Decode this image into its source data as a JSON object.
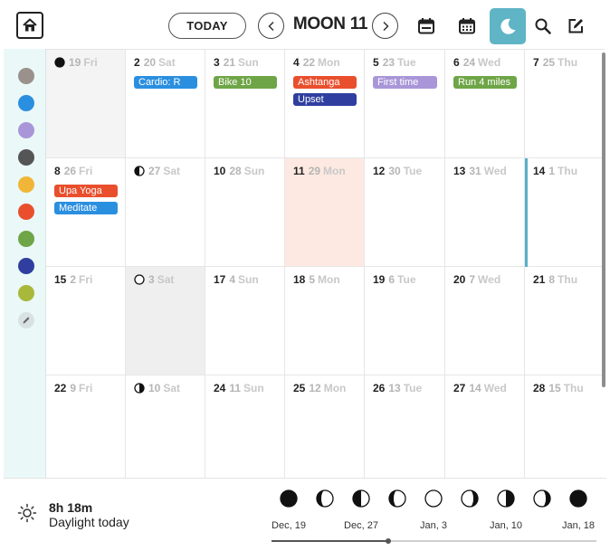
{
  "header": {
    "today_label": "TODAY",
    "title": "MOON 11",
    "home_icon": "home-icon",
    "prev_icon": "chevron-left-icon",
    "next_icon": "chevron-right-icon",
    "tools": [
      "week-calendar-icon",
      "month-calendar-icon",
      "moon-icon",
      "search-icon",
      "edit-icon"
    ],
    "active_tool": "moon-icon",
    "accent_color": "#5fb4c6"
  },
  "sidebar": {
    "swatches": [
      "#9a918d",
      "#2b8fe0",
      "#a996d8",
      "#555555",
      "#f1b637",
      "#e94f2d",
      "#6ea547",
      "#303f9f",
      "#a8b83b"
    ],
    "edit_icon": "pencil-icon"
  },
  "weeks": [
    [
      {
        "g": "",
        "m": "19",
        "w": "Fri",
        "moon": "new",
        "shade": true,
        "events": []
      },
      {
        "g": "2",
        "m": "20",
        "w": "Sat",
        "events": [
          {
            "label": "Cardio: R",
            "color": "#2b8fe0"
          }
        ]
      },
      {
        "g": "3",
        "m": "21",
        "w": "Sun",
        "events": [
          {
            "label": "Bike 10",
            "color": "#6ea547"
          }
        ]
      },
      {
        "g": "4",
        "m": "22",
        "w": "Mon",
        "events": [
          {
            "label": "Ashtanga",
            "color": "#e94f2d"
          },
          {
            "label": "Upset",
            "color": "#303f9f"
          }
        ]
      },
      {
        "g": "5",
        "m": "23",
        "w": "Tue",
        "events": [
          {
            "label": "First time",
            "color": "#a996d8"
          }
        ]
      },
      {
        "g": "6",
        "m": "24",
        "w": "Wed",
        "events": [
          {
            "label": "Run 4 miles",
            "color": "#6ea547"
          }
        ]
      },
      {
        "g": "7",
        "m": "25",
        "w": "Thu",
        "events": []
      }
    ],
    [
      {
        "g": "8",
        "m": "26",
        "w": "Fri",
        "events": [
          {
            "label": "Upa Yoga",
            "color": "#e94f2d"
          },
          {
            "label": "Meditate",
            "color": "#2b8fe0"
          }
        ]
      },
      {
        "g": "",
        "m": "27",
        "w": "Sat",
        "moon": "first-quarter",
        "events": []
      },
      {
        "g": "10",
        "m": "28",
        "w": "Sun",
        "events": []
      },
      {
        "g": "11",
        "m": "29",
        "w": "Mon",
        "today": true,
        "events": []
      },
      {
        "g": "12",
        "m": "30",
        "w": "Tue",
        "events": []
      },
      {
        "g": "13",
        "m": "31",
        "w": "Wed",
        "events": []
      },
      {
        "g": "14",
        "m": "1",
        "w": "Thu",
        "now_marker": true,
        "events": []
      }
    ],
    [
      {
        "g": "15",
        "m": "2",
        "w": "Fri",
        "events": []
      },
      {
        "g": "",
        "m": "3",
        "w": "Sat",
        "moon": "full",
        "shade2": true,
        "events": []
      },
      {
        "g": "17",
        "m": "4",
        "w": "Sun",
        "events": []
      },
      {
        "g": "18",
        "m": "5",
        "w": "Mon",
        "events": []
      },
      {
        "g": "19",
        "m": "6",
        "w": "Tue",
        "events": []
      },
      {
        "g": "20",
        "m": "7",
        "w": "Wed",
        "events": []
      },
      {
        "g": "21",
        "m": "8",
        "w": "Thu",
        "events": []
      }
    ],
    [
      {
        "g": "22",
        "m": "9",
        "w": "Fri",
        "events": []
      },
      {
        "g": "",
        "m": "10",
        "w": "Sat",
        "moon": "last-quarter",
        "events": []
      },
      {
        "g": "24",
        "m": "11",
        "w": "Sun",
        "events": []
      },
      {
        "g": "25",
        "m": "12",
        "w": "Mon",
        "events": []
      },
      {
        "g": "26",
        "m": "13",
        "w": "Tue",
        "events": []
      },
      {
        "g": "27",
        "m": "14",
        "w": "Wed",
        "events": []
      },
      {
        "g": "28",
        "m": "15",
        "w": "Thu",
        "events": []
      }
    ]
  ],
  "daylight": {
    "value": "8h 18m",
    "label": "Daylight today",
    "icon": "sun-icon"
  },
  "phases": [
    "new",
    "waxing-crescent",
    "first-quarter",
    "waxing-gibbous",
    "full",
    "waning-gibbous",
    "last-quarter",
    "waning-crescent",
    "new"
  ],
  "phase_labels": [
    "Dec, 19",
    "Dec, 27",
    "Jan, 3",
    "Jan, 10",
    "Jan, 18"
  ],
  "timeline_progress": 0.36
}
